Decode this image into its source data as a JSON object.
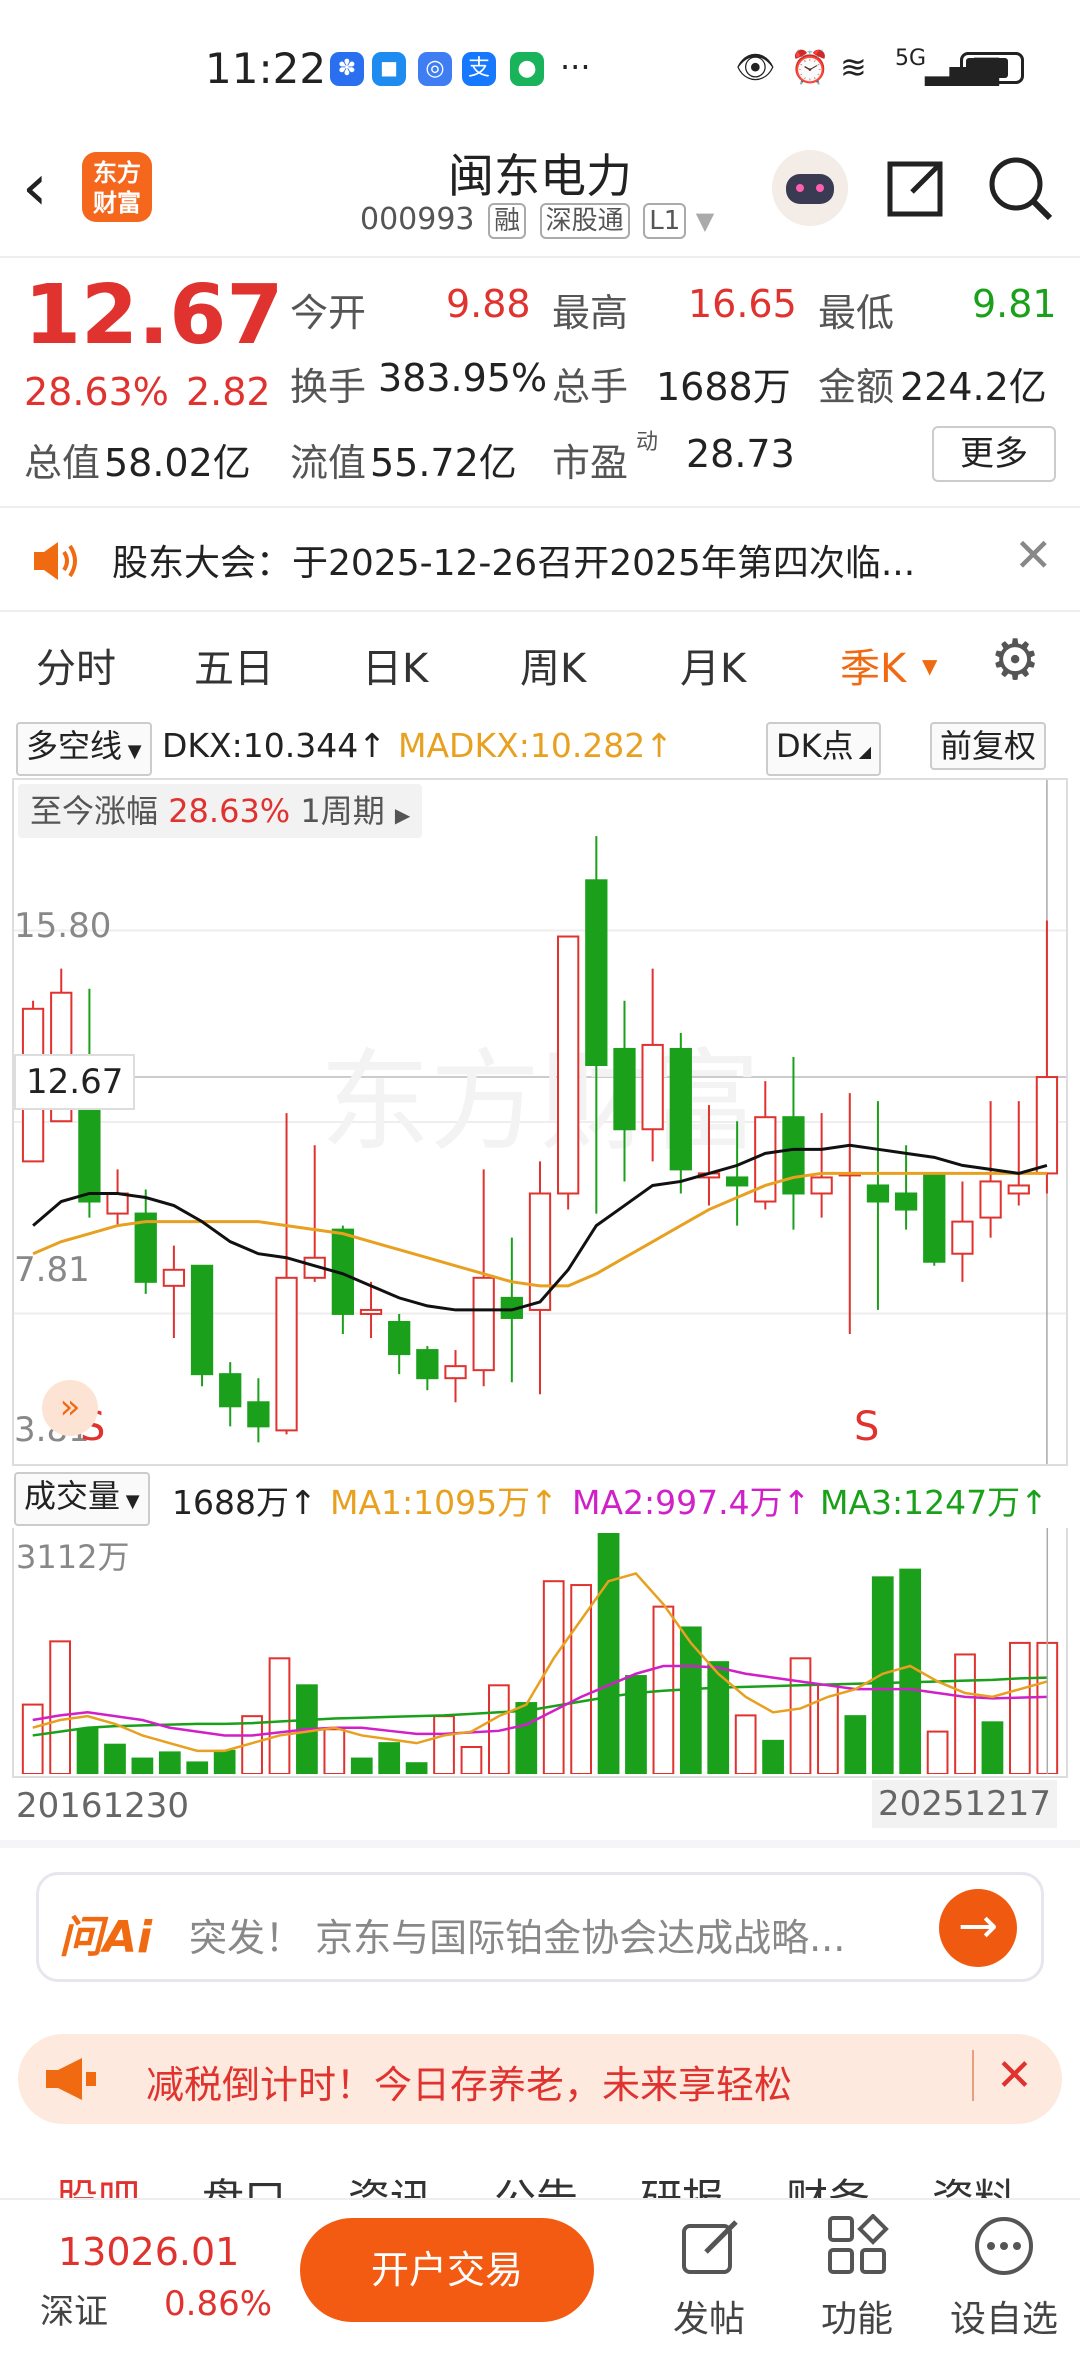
{
  "status_bar": {
    "time": "11:22",
    "network": "5G",
    "dots": "···"
  },
  "header": {
    "back_icon": "chevron-left",
    "logo_text_line1": "东方",
    "logo_text_line2": "财富",
    "stock_name": "闽东电力",
    "stock_code": "000993",
    "tag_rong": "融",
    "tag_connect": "深股通",
    "tag_level": "L1"
  },
  "quote": {
    "price": "12.67",
    "change_pct": "28.63%",
    "change_amt": "2.82",
    "open_label": "今开",
    "open_value": "9.88",
    "high_label": "最高",
    "high_value": "16.65",
    "low_label": "最低",
    "low_value": "9.81",
    "turnover_label": "换手",
    "turnover_value": "383.95%",
    "volume_label": "总手",
    "volume_value": "1688万",
    "amount_label": "金额",
    "amount_value": "224.2亿",
    "mktcap_label": "总值",
    "mktcap_value": "58.02亿",
    "float_label": "流值",
    "float_value": "55.72亿",
    "pe_label": "市盈",
    "pe_sup": "动",
    "pe_value": "28.73",
    "more_button": "更多"
  },
  "notice": {
    "text": "股东大会：于2025-12-26召开2025年第四次临..."
  },
  "tabs": [
    {
      "label": "分时",
      "active": false
    },
    {
      "label": "五日",
      "active": false
    },
    {
      "label": "日K",
      "active": false
    },
    {
      "label": "周K",
      "active": false
    },
    {
      "label": "月K",
      "active": false
    },
    {
      "label": "季K",
      "active": true
    }
  ],
  "kline_header": {
    "indicator_select": "多空线",
    "dkx": "DKX:10.344↑",
    "madkx": "MADKX:10.282↑",
    "dk_button": "DK点",
    "adjust_button": "前复权",
    "range_label": "至今涨幅",
    "range_value": "28.63%",
    "period_label": "1周期"
  },
  "volume_header": {
    "indicator_select": "成交量",
    "vol": "1688万↑",
    "ma1": "MA1:1095万↑",
    "ma2": "MA2:997.4万↑",
    "ma3": "MA3:1247万↑",
    "axis_max": "3112万",
    "date_start": "20161230",
    "date_end": "20251217"
  },
  "chart_data": [
    {
      "type": "candlestick",
      "y_axis_ticks": [
        "15.80",
        "7.81",
        "3.81"
      ],
      "last_price_label": "12.67",
      "ylim": [
        3.81,
        19.6
      ],
      "markers": [
        "S",
        "S"
      ],
      "candles": [
        {
          "o": 10.6,
          "c": 14.4,
          "h": 14.6,
          "l": 10.6
        },
        {
          "o": 11.6,
          "c": 14.8,
          "h": 15.4,
          "l": 11.6
        },
        {
          "o": 12.4,
          "c": 9.6,
          "h": 14.9,
          "l": 9.2
        },
        {
          "o": 9.3,
          "c": 9.8,
          "h": 10.4,
          "l": 9.0
        },
        {
          "o": 9.3,
          "c": 7.6,
          "h": 9.9,
          "l": 7.3
        },
        {
          "o": 7.5,
          "c": 7.9,
          "h": 8.5,
          "l": 6.2
        },
        {
          "o": 8.0,
          "c": 5.3,
          "h": 8.0,
          "l": 5.0
        },
        {
          "o": 5.3,
          "c": 4.5,
          "h": 5.6,
          "l": 4.0
        },
        {
          "o": 4.6,
          "c": 4.0,
          "h": 5.2,
          "l": 3.6
        },
        {
          "o": 3.9,
          "c": 7.7,
          "h": 11.8,
          "l": 3.8
        },
        {
          "o": 7.7,
          "c": 8.2,
          "h": 11.0,
          "l": 7.6
        },
        {
          "o": 8.9,
          "c": 6.8,
          "h": 9.0,
          "l": 6.3
        },
        {
          "o": 6.8,
          "c": 6.9,
          "h": 7.6,
          "l": 6.2
        },
        {
          "o": 6.6,
          "c": 5.8,
          "h": 6.8,
          "l": 5.3
        },
        {
          "o": 5.9,
          "c": 5.2,
          "h": 6.0,
          "l": 4.9
        },
        {
          "o": 5.2,
          "c": 5.5,
          "h": 5.9,
          "l": 4.6
        },
        {
          "o": 5.4,
          "c": 7.7,
          "h": 10.4,
          "l": 5.0
        },
        {
          "o": 7.2,
          "c": 6.7,
          "h": 8.7,
          "l": 5.1
        },
        {
          "o": 6.9,
          "c": 9.8,
          "h": 10.6,
          "l": 4.8
        },
        {
          "o": 9.8,
          "c": 16.2,
          "h": 16.2,
          "l": 9.4
        },
        {
          "o": 17.6,
          "c": 13.0,
          "h": 18.7,
          "l": 9.3
        },
        {
          "o": 13.4,
          "c": 11.4,
          "h": 14.6,
          "l": 10.1
        },
        {
          "o": 11.4,
          "c": 13.5,
          "h": 15.4,
          "l": 10.6
        },
        {
          "o": 13.4,
          "c": 10.4,
          "h": 13.8,
          "l": 9.8
        },
        {
          "o": 10.2,
          "c": 10.3,
          "h": 12.0,
          "l": 9.5
        },
        {
          "o": 10.2,
          "c": 10.0,
          "h": 11.6,
          "l": 9.0
        },
        {
          "o": 9.6,
          "c": 11.7,
          "h": 12.6,
          "l": 9.4
        },
        {
          "o": 11.7,
          "c": 9.8,
          "h": 13.2,
          "l": 8.9
        },
        {
          "o": 9.8,
          "c": 10.2,
          "h": 11.8,
          "l": 9.2
        },
        {
          "o": 10.3,
          "c": 10.3,
          "h": 12.3,
          "l": 6.3
        },
        {
          "o": 10.0,
          "c": 9.6,
          "h": 12.1,
          "l": 6.9
        },
        {
          "o": 9.8,
          "c": 9.4,
          "h": 11.0,
          "l": 8.9
        },
        {
          "o": 10.3,
          "c": 8.1,
          "h": 10.3,
          "l": 8.0
        },
        {
          "o": 8.3,
          "c": 9.1,
          "h": 10.1,
          "l": 7.6
        },
        {
          "o": 9.2,
          "c": 10.1,
          "h": 12.1,
          "l": 8.7
        },
        {
          "o": 9.8,
          "c": 10.0,
          "h": 12.1,
          "l": 9.5
        },
        {
          "o": 10.3,
          "c": 12.7,
          "h": 16.6,
          "l": 9.8
        }
      ],
      "ma_dkx": [
        9.0,
        9.6,
        9.8,
        9.8,
        9.7,
        9.5,
        9.1,
        8.6,
        8.3,
        8.2,
        8.0,
        7.8,
        7.5,
        7.2,
        7.0,
        6.9,
        6.9,
        6.9,
        7.1,
        7.9,
        9.0,
        9.5,
        10.0,
        10.1,
        10.3,
        10.5,
        10.8,
        10.9,
        10.9,
        11.0,
        10.9,
        10.8,
        10.7,
        10.5,
        10.4,
        10.3,
        10.5
      ],
      "ma_madkx": [
        8.3,
        8.6,
        8.8,
        9.0,
        9.1,
        9.1,
        9.1,
        9.1,
        9.1,
        9.0,
        8.9,
        8.8,
        8.6,
        8.4,
        8.2,
        8.0,
        7.8,
        7.6,
        7.5,
        7.5,
        7.8,
        8.2,
        8.6,
        9.0,
        9.4,
        9.7,
        10.0,
        10.2,
        10.3,
        10.3,
        10.3,
        10.3,
        10.3,
        10.3,
        10.3,
        10.3,
        10.3
      ]
    },
    {
      "type": "bar",
      "title": "成交量",
      "ylim": [
        0,
        3112
      ],
      "values_wan": [
        900,
        1720,
        580,
        380,
        200,
        280,
        150,
        300,
        750,
        1500,
        1150,
        580,
        200,
        400,
        140,
        750,
        350,
        1150,
        920,
        2500,
        2450,
        3112,
        1270,
        2170,
        1900,
        1450,
        760,
        430,
        1500,
        1160,
        750,
        2550,
        2650,
        550,
        1550,
        670,
        1700,
        1700
      ],
      "up": [
        true,
        true,
        false,
        false,
        false,
        false,
        false,
        false,
        true,
        true,
        false,
        true,
        false,
        false,
        false,
        true,
        true,
        true,
        false,
        true,
        true,
        false,
        false,
        true,
        false,
        false,
        true,
        false,
        true,
        true,
        false,
        false,
        false,
        true,
        true,
        false,
        true,
        true
      ],
      "ma1": [
        600,
        700,
        750,
        650,
        500,
        400,
        300,
        300,
        400,
        500,
        550,
        600,
        500,
        450,
        400,
        500,
        550,
        750,
        900,
        1500,
        2000,
        2500,
        2600,
        2200,
        1700,
        1300,
        1000,
        800,
        850,
        1000,
        1100,
        1300,
        1400,
        1200,
        1050,
        1000,
        1100,
        1200
      ],
      "ma2": [
        700,
        760,
        800,
        750,
        700,
        600,
        550,
        500,
        500,
        540,
        580,
        600,
        600,
        560,
        520,
        520,
        540,
        560,
        640,
        820,
        1000,
        1150,
        1300,
        1400,
        1400,
        1380,
        1300,
        1250,
        1200,
        1150,
        1100,
        1100,
        1100,
        1050,
        1000,
        980,
        990,
        1000
      ],
      "ma3": [
        500,
        550,
        600,
        620,
        630,
        640,
        650,
        650,
        660,
        680,
        700,
        720,
        730,
        740,
        750,
        760,
        780,
        800,
        820,
        880,
        940,
        1000,
        1050,
        1080,
        1100,
        1120,
        1130,
        1140,
        1150,
        1160,
        1170,
        1180,
        1190,
        1200,
        1210,
        1220,
        1240,
        1250
      ]
    }
  ],
  "ai_bar": {
    "brand": "问Ai",
    "text": "突发！ 京东与国际铂金协会达成战略..."
  },
  "promo": {
    "text": "减税倒计时！今日存养老，未来享轻松"
  },
  "subtabs": [
    "股吧",
    "盘口",
    "资讯",
    "公告",
    "研报",
    "财务",
    "资料"
  ],
  "bottom": {
    "index_value": "13026.01",
    "index_name": "深证",
    "index_change": "0.86%",
    "trade_button": "开户交易",
    "post": "发帖",
    "functions": "功能",
    "watch": "设自选"
  },
  "colors": {
    "up": "#e0322e",
    "down": "#1aa01a",
    "accent": "#f06a12",
    "dkx_line": "#111111",
    "madkx_line": "#e8a020",
    "ma1": "#e8a020",
    "ma2": "#d020c8",
    "ma3": "#1aa01a"
  }
}
